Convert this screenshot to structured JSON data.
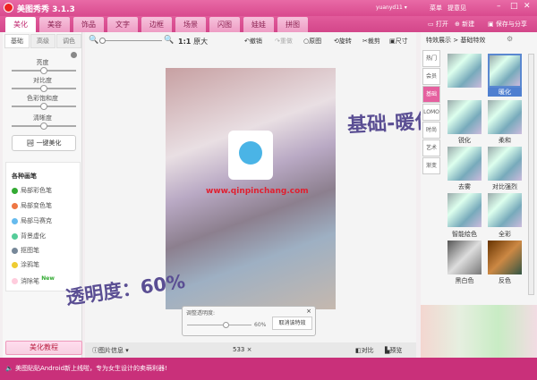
{
  "app": {
    "title": "美图秀秀 3.1.3",
    "user": "yuanyd11 ▾",
    "menu": "菜单",
    "feedback": "提意见"
  },
  "tabs": [
    "美化",
    "美容",
    "饰品",
    "文字",
    "边框",
    "场景",
    "闪图",
    "娃娃",
    "拼图"
  ],
  "top_actions": {
    "open": "打开",
    "new": "新建",
    "save": "保存与分享"
  },
  "toolbar": {
    "zoom_label": "1:1",
    "original_size": "原大",
    "undo": "撤销",
    "redo": "重做",
    "original": "原图",
    "rotate": "旋转",
    "crop": "裁剪",
    "size": "尺寸"
  },
  "left": {
    "subtabs": [
      "基础",
      "高级",
      "调色"
    ],
    "sliders": [
      "亮度",
      "对比度",
      "色彩饱和度",
      "清晰度"
    ],
    "one_click": "一键美化",
    "brush_title": "各种画笔",
    "brushes": [
      "局部彩色笔",
      "局部变色笔",
      "局部马赛克",
      "背景虚化",
      "抠图笔",
      "涂鸦笔",
      "消除笔"
    ],
    "new_badge": "New",
    "tutorial": "美化教程"
  },
  "canvas": {
    "watermark": "www.qinpinchang.com",
    "image_info": "图片信息",
    "dimensions": "533 ×",
    "compare": "对比",
    "preview": "预览"
  },
  "popup": {
    "title": "调整透明度:",
    "value": "60%",
    "cancel": "取消该特效",
    "opacity": 0.6
  },
  "annotations": {
    "effect": "基础-暖化",
    "opacity": "透明度：60%"
  },
  "right": {
    "breadcrumb": "特效展示 > 基础特效",
    "categories": [
      "热门",
      "会员",
      "基础",
      "LOMO",
      "时尚",
      "艺术",
      "渐变"
    ],
    "effects": [
      "",
      "暖化",
      "锐化",
      "柔和",
      "去雾",
      "对比强烈",
      "智能绘色",
      "全彩",
      "黑白色",
      "反色"
    ]
  },
  "status": "美图贴贴Android新上线啦，专为女生设计的卖萌利器!"
}
